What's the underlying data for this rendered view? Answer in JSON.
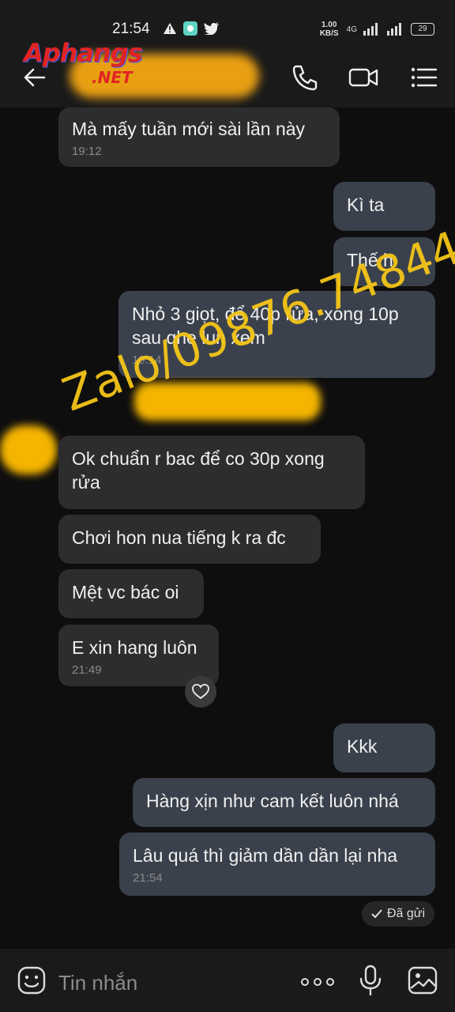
{
  "status_bar": {
    "time": "21:54",
    "net_speed": "1.00 KB/S",
    "network": "4G",
    "battery": "29"
  },
  "logo": {
    "main": "Aphangs",
    "sub": ".NET"
  },
  "header": {
    "contact_name_redacted": ""
  },
  "watermark": "Zalo/09876.74844",
  "messages": [
    {
      "id": "m1",
      "dir": "in",
      "text": "Mà mấy tuần mới sài lần này",
      "time": "19:12"
    },
    {
      "id": "m2",
      "dir": "out",
      "text": "Kì ta",
      "time": ""
    },
    {
      "id": "m3",
      "dir": "out",
      "text": "Thế h",
      "time": ""
    },
    {
      "id": "m4",
      "dir": "out",
      "text": "Nhỏ 3 giọt, để 40p rửa, xong 10p sau qhe lun xem",
      "time": "19:14"
    },
    {
      "id": "m5",
      "dir": "in",
      "text": "Ok chuẩn r bac để co 30p xong rửa",
      "time": ""
    },
    {
      "id": "m6",
      "dir": "in",
      "text": "Chơi hon nua tiếng k ra đc",
      "time": ""
    },
    {
      "id": "m7",
      "dir": "in",
      "text": "Mệt vc bác oi",
      "time": ""
    },
    {
      "id": "m8",
      "dir": "in",
      "text": "E xin hang luôn",
      "time": "21:49"
    },
    {
      "id": "m9",
      "dir": "out",
      "text": "Kkk",
      "time": ""
    },
    {
      "id": "m10",
      "dir": "out",
      "text": "Hàng xịn như cam kết luôn nhá",
      "time": ""
    },
    {
      "id": "m11",
      "dir": "out",
      "text": "Lâu quá thì giảm dần dần lại nha",
      "time": "21:54"
    }
  ],
  "sent_status": "Đã gửi",
  "input": {
    "placeholder": "Tin nhắn"
  },
  "colors": {
    "incoming": "#2d2d2f",
    "outgoing": "#3a414c",
    "background": "#0e0e0e",
    "watermark": "#f5c518"
  }
}
